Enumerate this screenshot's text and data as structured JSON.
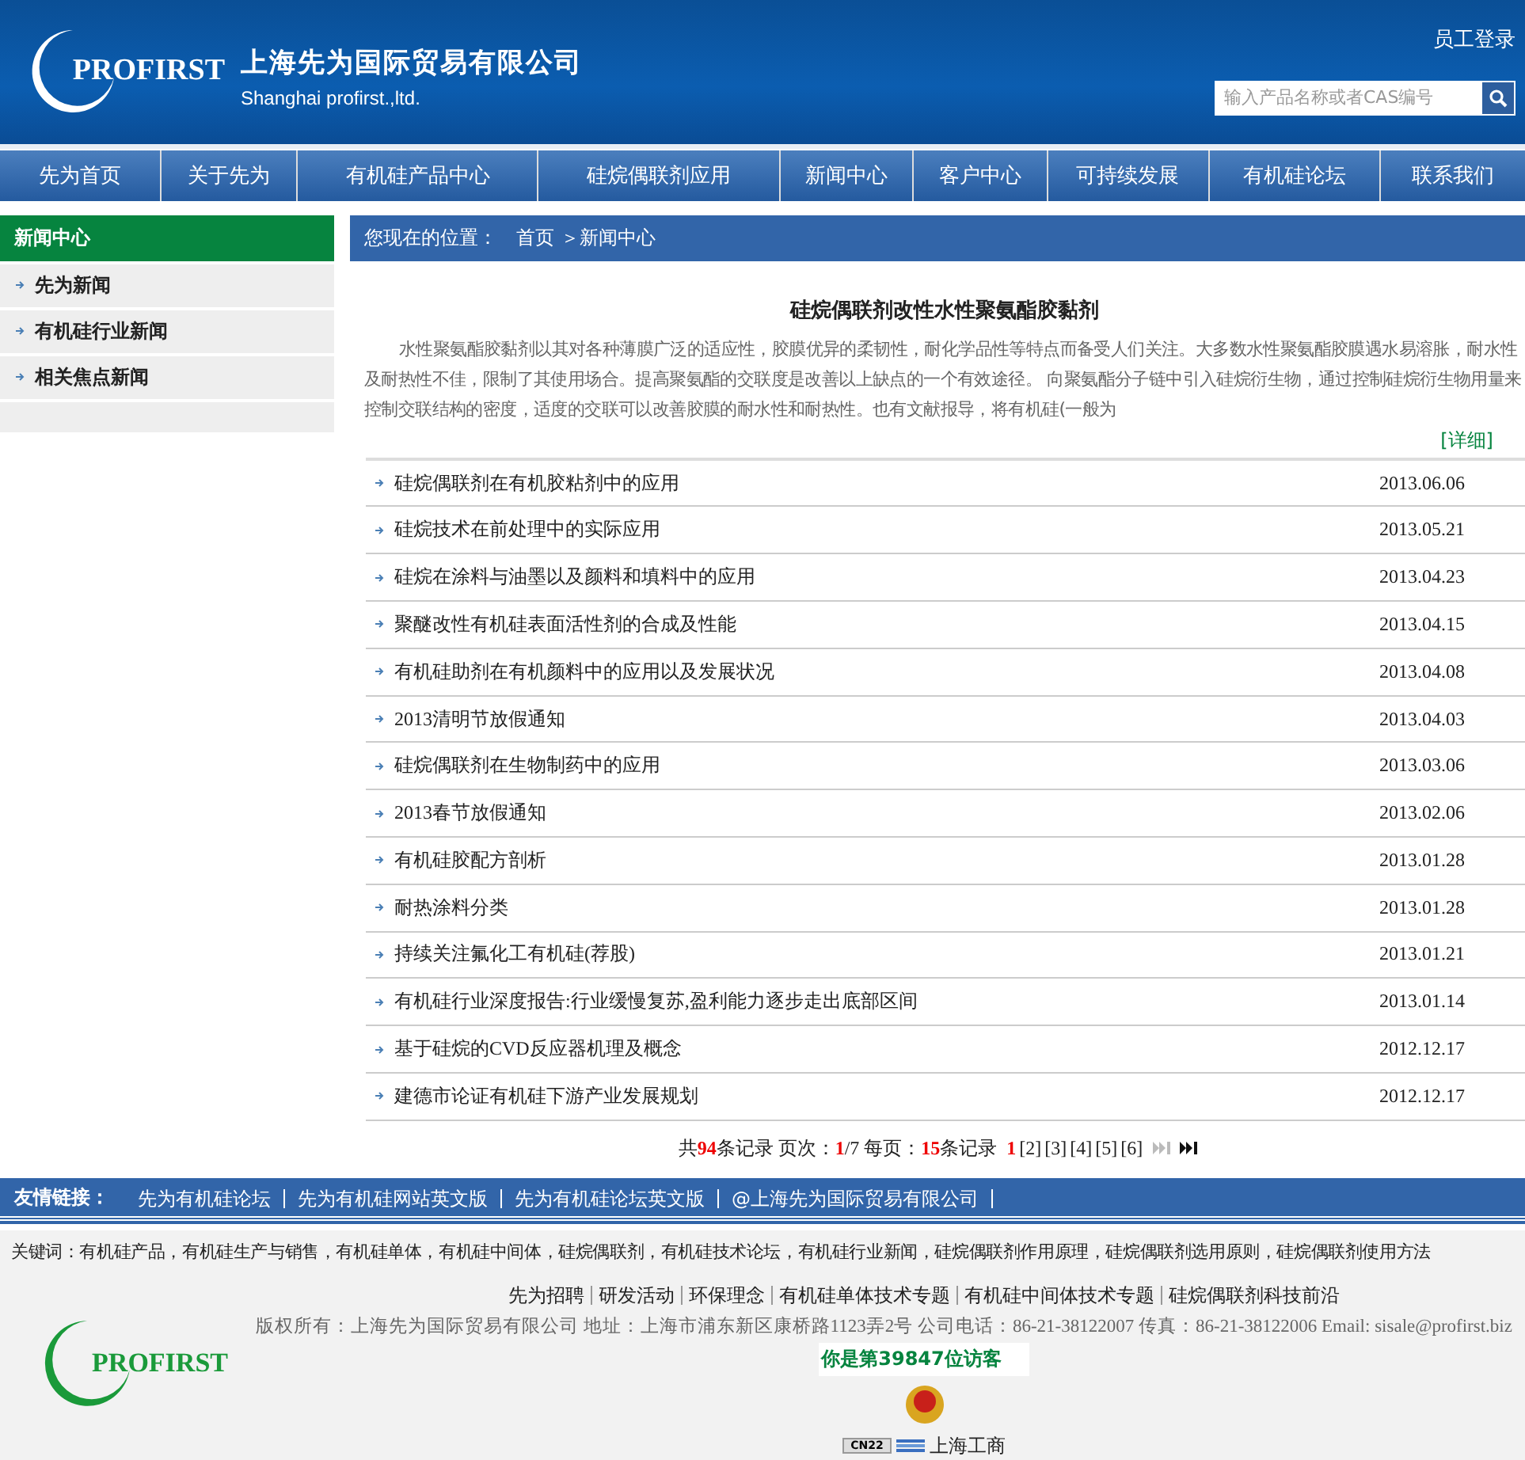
{
  "header": {
    "logo_text": "PROFIRST",
    "company_cn": "上海先为国际贸易有限公司",
    "company_en": "Shanghai profirst.,ltd.",
    "login": "员工登录",
    "search": {
      "placeholder": "输入产品名称或者CAS编号"
    }
  },
  "nav": [
    "先为首页",
    "关于先为",
    "有机硅产品中心",
    "硅烷偶联剂应用",
    "新闻中心",
    "客户中心",
    "可持续发展",
    "有机硅论坛",
    "联系我们"
  ],
  "sidebar": {
    "title": "新闻中心",
    "items": [
      "先为新闻",
      "有机硅行业新闻",
      "相关焦点新闻"
    ]
  },
  "breadcrumb": {
    "label": "您现在的位置：",
    "path": "首页 ＞新闻中心"
  },
  "featured": {
    "title": "硅烷偶联剂改性水性聚氨酯胶黏剂",
    "summary": "水性聚氨酯胶黏剂以其对各种薄膜广泛的适应性，胶膜优异的柔韧性，耐化学品性等特点而备受人们关注。大多数水性聚氨酯胶膜遇水易溶胀，耐水性及耐热性不佳，限制了其使用场合。提高聚氨酯的交联度是改善以上缺点的一个有效途径。 向聚氨酯分子链中引入硅烷衍生物，通过控制硅烷衍生物用量来控制交联结构的密度，适度的交联可以改善胶膜的耐水性和耐热性。也有文献报导，将有机硅(一般为",
    "more": "[详细]"
  },
  "news": [
    {
      "title": "硅烷偶联剂在有机胶粘剂中的应用",
      "date": "2013.06.06"
    },
    {
      "title": "硅烷技术在前处理中的实际应用",
      "date": "2013.05.21"
    },
    {
      "title": "硅烷在涂料与油墨以及颜料和填料中的应用",
      "date": "2013.04.23"
    },
    {
      "title": "聚醚改性有机硅表面活性剂的合成及性能",
      "date": "2013.04.15"
    },
    {
      "title": "有机硅助剂在有机颜料中的应用以及发展状况",
      "date": "2013.04.08"
    },
    {
      "title": "2013清明节放假通知",
      "date": "2013.04.03"
    },
    {
      "title": "硅烷偶联剂在生物制药中的应用",
      "date": "2013.03.06"
    },
    {
      "title": "2013春节放假通知",
      "date": "2013.02.06"
    },
    {
      "title": "有机硅胶配方剖析",
      "date": "2013.01.28"
    },
    {
      "title": "耐热涂料分类",
      "date": "2013.01.28"
    },
    {
      "title": "持续关注氟化工有机硅(荐股)",
      "date": "2013.01.21"
    },
    {
      "title": "有机硅行业深度报告:行业缓慢复苏,盈利能力逐步走出底部区间",
      "date": "2013.01.14"
    },
    {
      "title": "基于硅烷的CVD反应器机理及概念",
      "date": "2012.12.17"
    },
    {
      "title": "建德市论证有机硅下游产业发展规划",
      "date": "2012.12.17"
    }
  ],
  "pager": {
    "parts": [
      {
        "text": "共",
        "highlight": false
      },
      {
        "text": "94",
        "highlight": true
      },
      {
        "text": "条记录 页次：",
        "highlight": false
      },
      {
        "text": "1",
        "highlight": true
      },
      {
        "text": "/7 每页：",
        "highlight": false
      },
      {
        "text": "15",
        "highlight": true
      },
      {
        "text": "条记录",
        "highlight": false
      }
    ],
    "pages": [
      {
        "label": "1",
        "selected": true
      },
      {
        "label": "[2]",
        "selected": false
      },
      {
        "label": "[3]",
        "selected": false
      },
      {
        "label": "[4]",
        "selected": false
      },
      {
        "label": "[5]",
        "selected": false
      },
      {
        "label": "[6]",
        "selected": false
      }
    ],
    "next_disabled": true,
    "last_disabled": false
  },
  "friend_links": {
    "label": "友情链接：",
    "links": [
      "先为有机硅论坛",
      "先为有机硅网站英文版",
      "先为有机硅论坛英文版",
      "@上海先为国际贸易有限公司"
    ]
  },
  "keywords": "关键词：有机硅产品，有机硅生产与销售，有机硅单体，有机硅中间体，硅烷偶联剂，有机硅技术论坛，有机硅行业新闻，硅烷偶联剂作用原理，硅烷偶联剂选用原则，硅烷偶联剂使用方法",
  "footer": {
    "links": [
      "先为招聘",
      "研发活动",
      "环保理念",
      "有机硅单体技术专题",
      "有机硅中间体技术专题",
      "硅烷偶联剂科技前沿"
    ],
    "copyright": "版权所有：上海先为国际贸易有限公司  地址：上海市浦东新区康桥路1123弄2号  公司电话：86-21-38122007  传真：86-21-38122006 Email: sisale@profirst.biz",
    "visitor": "你是第39847位访客",
    "logo_text": "PROFIRST",
    "badge_code": "CN22",
    "badge_label": "上海工商"
  }
}
